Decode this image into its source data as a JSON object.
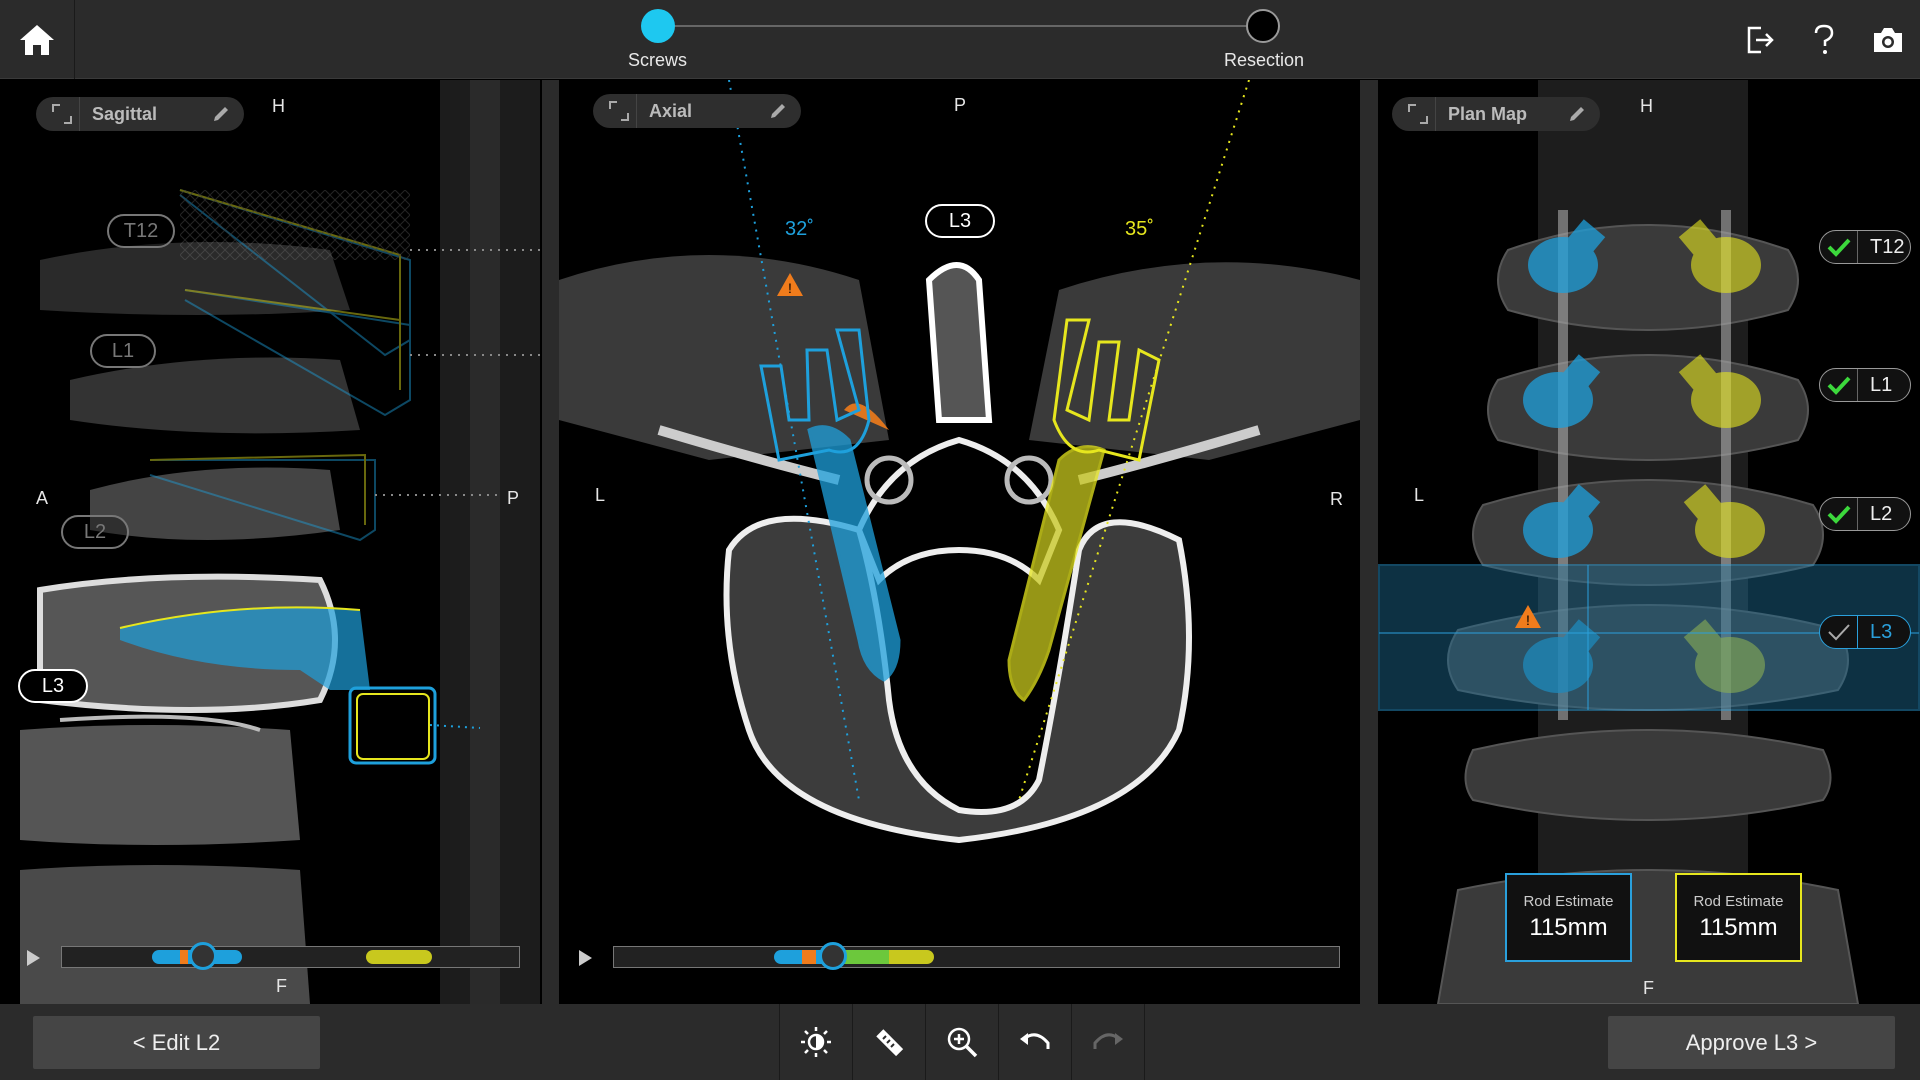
{
  "workflow": {
    "steps": [
      {
        "label": "Screws",
        "state": "active"
      },
      {
        "label": "Resection",
        "state": "pending"
      }
    ]
  },
  "icons": {
    "home": "home-icon",
    "exit": "exit-icon",
    "help": "help-icon",
    "camera": "camera-icon"
  },
  "sagittal": {
    "title": "Sagittal",
    "orient_top": "H",
    "orient_left": "A",
    "orient_right": "P",
    "orient_bottom": "F",
    "levels": [
      "T12",
      "L1",
      "L2",
      "L3"
    ],
    "active_level": "L3"
  },
  "axial": {
    "title": "Axial",
    "orient_top": "P",
    "orient_left": "L",
    "orient_right": "R",
    "level": "L3",
    "left_angle": "32˚",
    "right_angle": "35˚"
  },
  "planmap": {
    "title": "Plan Map",
    "orient_top": "H",
    "orient_left": "L",
    "orient_bottom": "F",
    "levels": [
      {
        "name": "T12",
        "approved": true
      },
      {
        "name": "L1",
        "approved": true
      },
      {
        "name": "L2",
        "approved": true
      },
      {
        "name": "L3",
        "approved": false
      }
    ],
    "rod_left": {
      "title": "Rod Estimate",
      "value": "115mm"
    },
    "rod_right": {
      "title": "Rod Estimate",
      "value": "115mm"
    }
  },
  "bottom": {
    "back_label": "< Edit L2",
    "next_label": "Approve L3 >",
    "tools": [
      "brightness-icon",
      "ruler-icon",
      "zoom-icon",
      "undo-icon",
      "redo-icon"
    ]
  },
  "colors": {
    "left_screw": "#1ea0dc",
    "right_screw": "#e6e61e",
    "warning": "#f07c1c",
    "step_active": "#1ec8f0",
    "approved_check": "#3cd83c"
  }
}
